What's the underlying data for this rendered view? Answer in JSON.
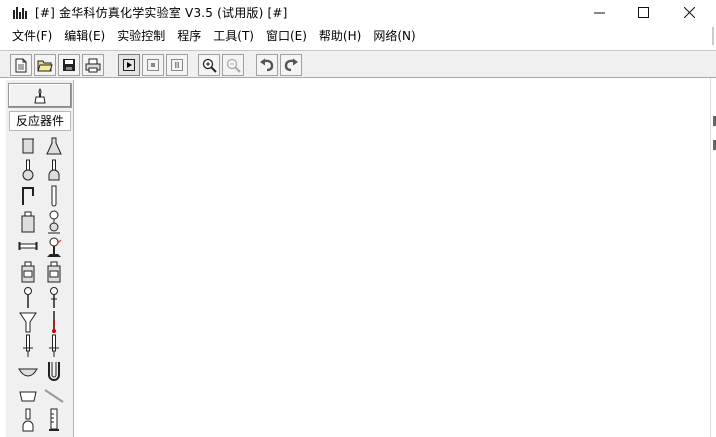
{
  "window": {
    "title": "[#] 金华科仿真化学实验室 V3.5  (试用版) [#]",
    "controls": {
      "minimize": "—",
      "maximize": "☐",
      "close": "✕"
    }
  },
  "menu": [
    "文件(F)",
    "编辑(E)",
    "实验控制",
    "程序",
    "工具(T)",
    "窗口(E)",
    "帮助(H)",
    "网络(N)"
  ],
  "toolbar": {
    "buttons": [
      {
        "name": "new-file-icon"
      },
      {
        "name": "open-folder-icon"
      },
      {
        "name": "save-icon"
      },
      {
        "name": "print-icon"
      },
      {
        "name": "play-icon",
        "state": "pressed"
      },
      {
        "name": "stop-icon"
      },
      {
        "name": "pause-icon"
      },
      {
        "name": "zoom-in-icon"
      },
      {
        "name": "zoom-out-icon",
        "state": "disabled"
      },
      {
        "name": "undo-icon"
      },
      {
        "name": "redo-icon"
      }
    ]
  },
  "palette": {
    "top_button_icon": "alcohol-lamp-icon",
    "category": "反应器件",
    "items": [
      "beaker-icon",
      "conical-flask-icon",
      "round-flask-icon",
      "flat-flask-icon",
      "bent-tube-icon",
      "test-tube-icon",
      "reagent-bottle-icon",
      "separatory-device-icon",
      "glass-tube-icon",
      "retort-stand-icon",
      "gas-bottle-icon",
      "gas-bottle-2-icon",
      "dropper-icon",
      "dropper-2-icon",
      "funnel-icon",
      "thermometer-icon",
      "burette-icon",
      "burette-2-icon",
      "evaporating-dish-icon",
      "u-tube-icon",
      "crucible-icon",
      "glass-rod-icon",
      "small-flask-icon",
      "measuring-cylinder-icon"
    ]
  },
  "colors": {
    "toolbar_bg": "#f0f0f0",
    "canvas_bg": "#ffffff",
    "play_accent": "#000000"
  }
}
